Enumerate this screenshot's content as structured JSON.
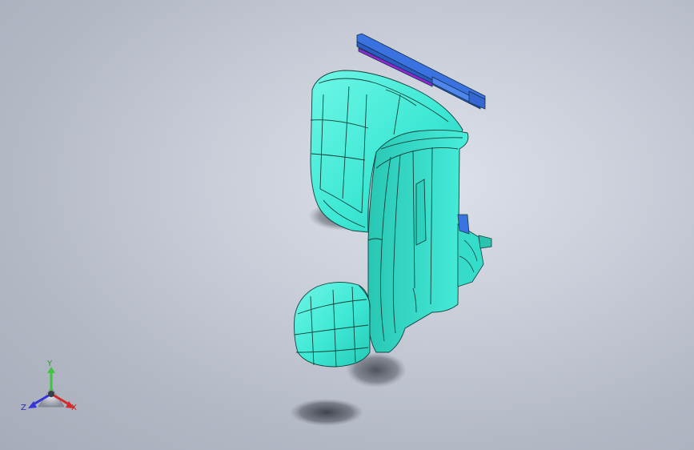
{
  "viewport": {
    "background": "#c3c8d3",
    "model": {
      "main_color": "#3de8d4",
      "edge_color": "#14403a",
      "rail_color": "#3a72e0",
      "rail_slot_color": "#8e2ad0"
    }
  },
  "triad": {
    "y_label": "Y",
    "z_label": "Z",
    "x_label": "X",
    "y_color": "#3ec43e",
    "z_color": "#3535d8",
    "x_color": "#d42a2a"
  }
}
